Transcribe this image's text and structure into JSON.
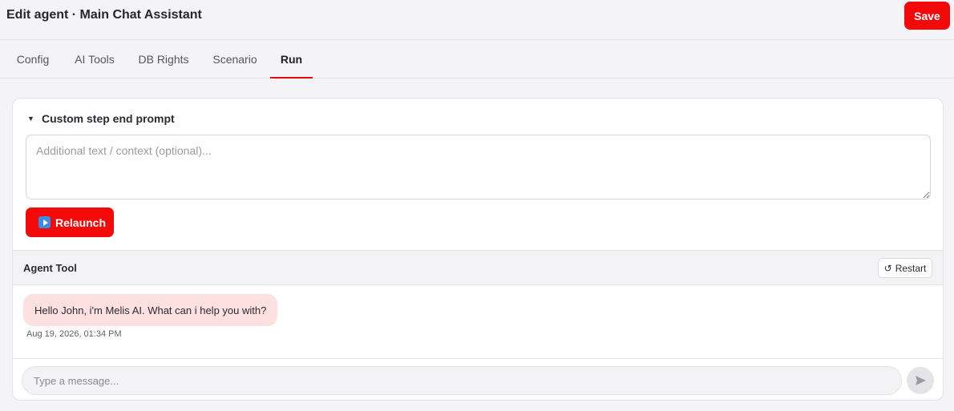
{
  "header": {
    "title": "Edit agent · Main Chat Assistant",
    "save_label": "Save"
  },
  "tabs": [
    {
      "label": "Config"
    },
    {
      "label": "AI Tools"
    },
    {
      "label": "DB Rights"
    },
    {
      "label": "Scenario"
    },
    {
      "label": "Run",
      "active": true
    }
  ],
  "run": {
    "prompt_section_label": "Custom step end prompt",
    "context_placeholder": "Additional text / context (optional)...",
    "context_value": "",
    "relaunch_label": "Relaunch"
  },
  "agent_tool": {
    "title": "Agent Tool",
    "restart_label": "Restart",
    "messages": [
      {
        "text": "Hello John, i'm Melis AI. What can i help you with?",
        "time": "Aug 19, 2026, 01:34 PM"
      }
    ],
    "input_placeholder": "Type a message..."
  },
  "icons": {
    "caret": "caret-down-icon",
    "relaunch": "play-icon",
    "restart": "restart-icon",
    "send": "send-icon"
  },
  "colors": {
    "accent": "#f20a0a",
    "bubble": "#fde0e0",
    "play_icon": "#3d8be8"
  }
}
